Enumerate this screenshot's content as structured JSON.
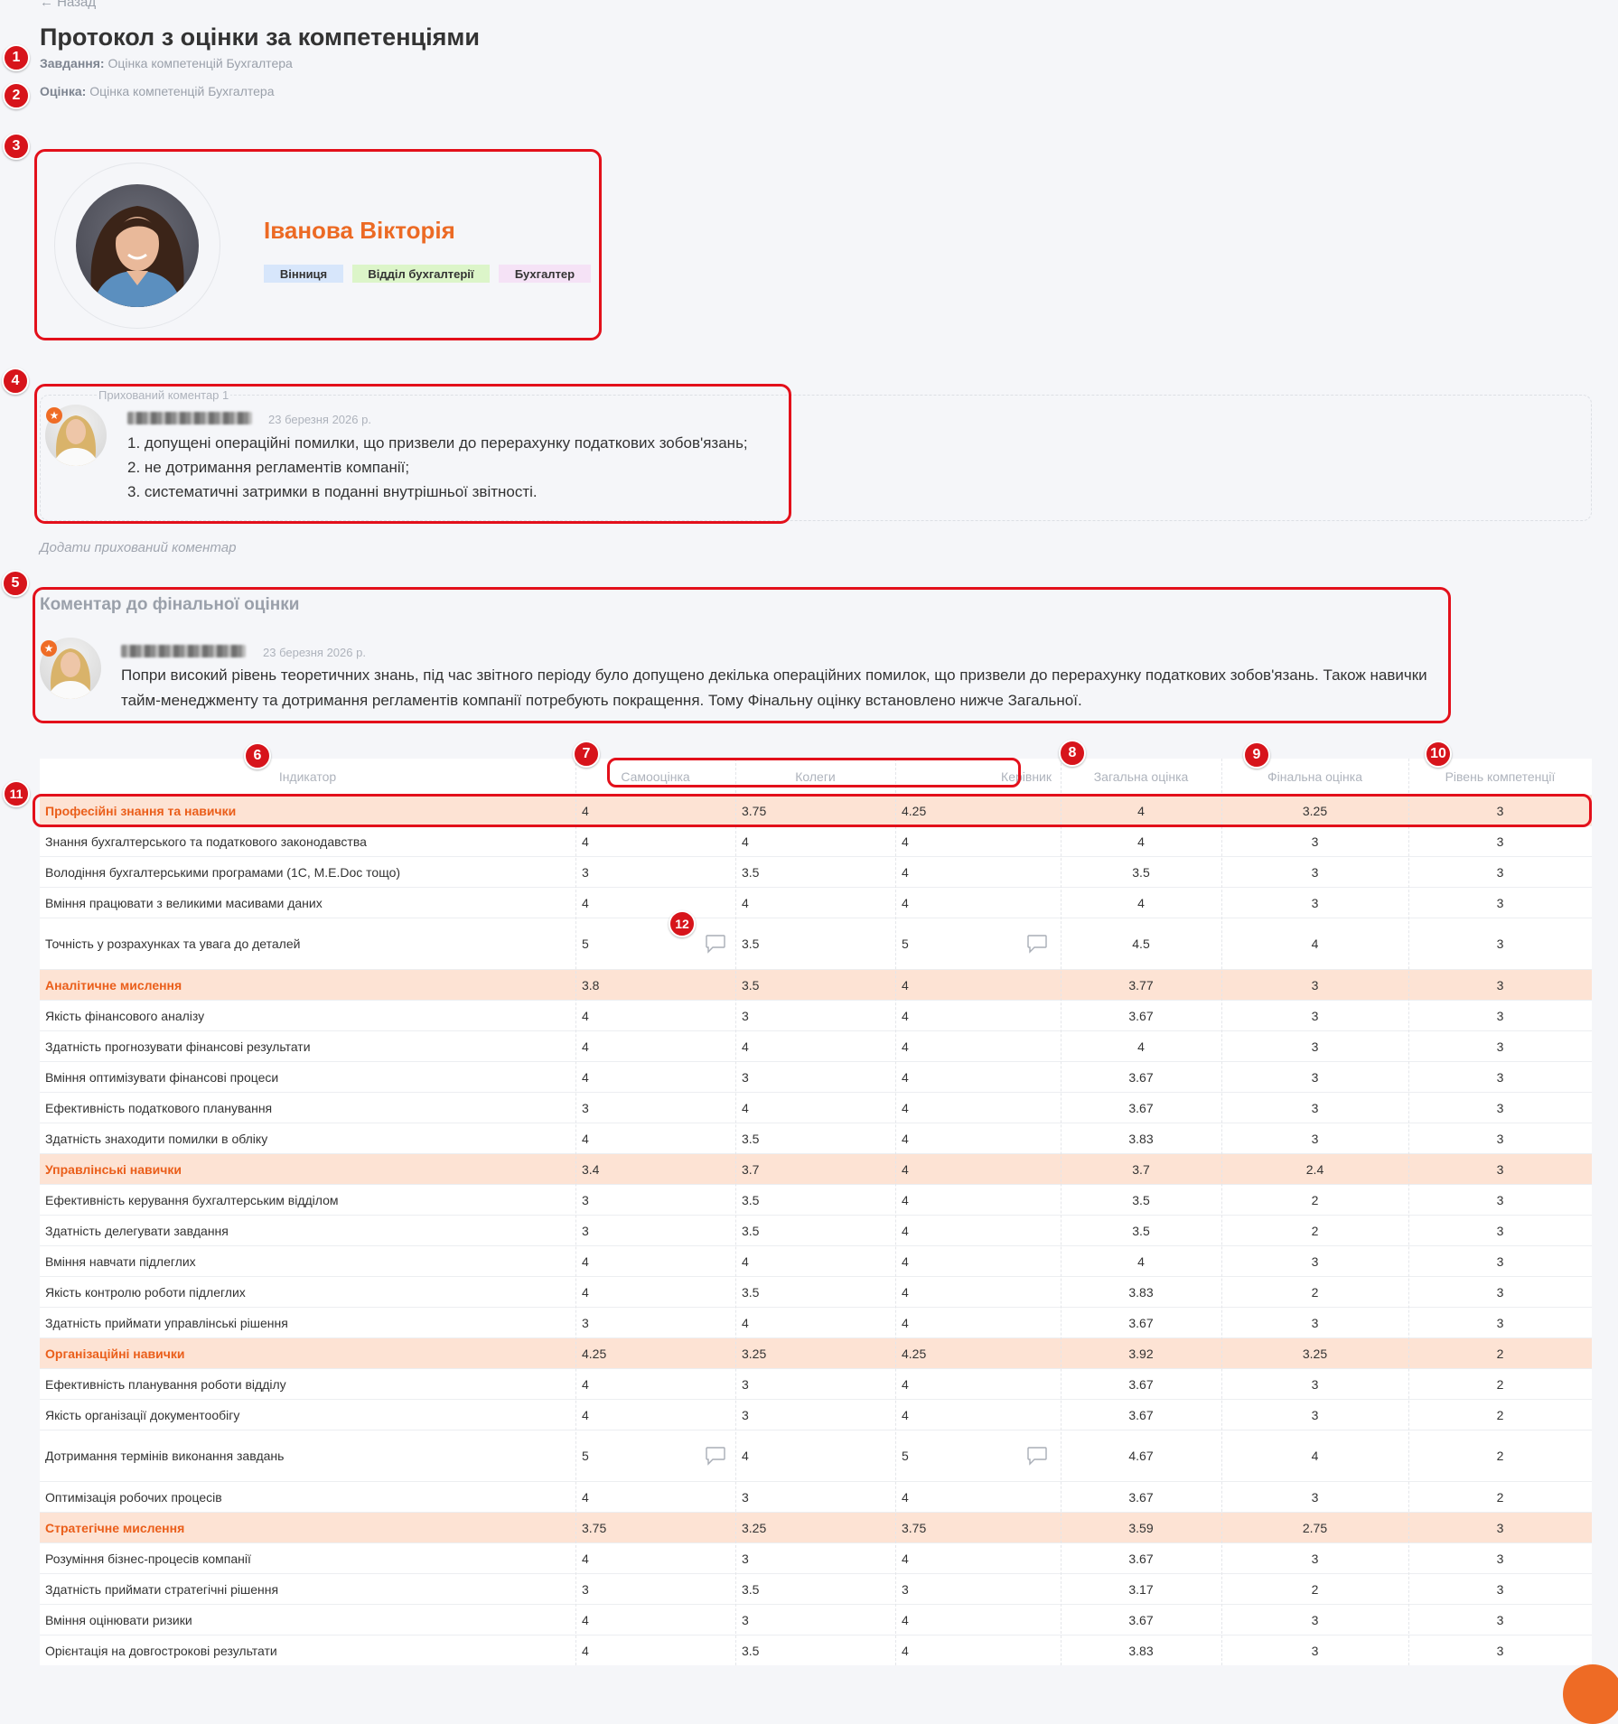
{
  "nav": {
    "back_label": "Назад"
  },
  "page": {
    "title": "Протокол з оцінки за компетенціями",
    "task_label": "Завдання:",
    "task_value": "Оцінка компетенцій Бухгалтера",
    "assessment_label": "Оцінка:",
    "assessment_value": "Оцінка компетенцій Бухгалтера"
  },
  "markers": [
    "1",
    "2",
    "3",
    "4",
    "5",
    "6",
    "7",
    "8",
    "9",
    "10",
    "11",
    "12"
  ],
  "employee": {
    "name": "Іванова Вікторія",
    "city": "Вінниця",
    "department": "Відділ бухгалтерії",
    "position": "Бухгалтер"
  },
  "hidden_comment": {
    "label": "Прихований коментар 1",
    "date": "23 березня 2026 р.",
    "lines": [
      "1. допущені операційні помилки, що призвели до перерахунку податкових зобов'язань;",
      "2. не дотримання регламентів компанії;",
      "3. систематичні затримки в поданні внутрішньої звітності."
    ],
    "add_label": "Додати прихований коментар"
  },
  "final_comment": {
    "title": "Коментар до фінальної оцінки",
    "date": "23 березня 2026 р.",
    "text": "Попри високий рівень теоретичних знань, під час звітного періоду було допущено декілька операційних помилок, що призвели до перерахунку податкових зобов'язань. Також навички тайм-менеджменту та дотримання регламентів компанії потребують покращення. Тому Фінальну оцінку встановлено нижче Загальної."
  },
  "table": {
    "headers": {
      "indicator": "Індикатор",
      "self": "Самооцінка",
      "colleagues": "Колеги",
      "manager": "Керівник",
      "overall": "Загальна оцінка",
      "final": "Фінальна оцінка",
      "level": "Рівень компетенції"
    },
    "rows": [
      {
        "cat": true,
        "name": "Професійні знання та навички",
        "v": [
          "4",
          "3.75",
          "4.25",
          "4",
          "3.25",
          "3"
        ]
      },
      {
        "cat": false,
        "name": "Знання бухгалтерського та податкового законодавства",
        "v": [
          "4",
          "4",
          "4",
          "4",
          "3",
          "3"
        ]
      },
      {
        "cat": false,
        "name": "Володіння бухгалтерськими програмами (1С, M.E.Doc тощо)",
        "v": [
          "3",
          "3.5",
          "4",
          "3.5",
          "3",
          "3"
        ]
      },
      {
        "cat": false,
        "name": "Вміння працювати з великими масивами даних",
        "v": [
          "4",
          "4",
          "4",
          "4",
          "3",
          "3"
        ]
      },
      {
        "cat": false,
        "name": "Точність у розрахунках та увага до деталей",
        "v": [
          "5",
          "3.5",
          "5",
          "4.5",
          "4",
          "3"
        ],
        "comments": true
      },
      {
        "cat": true,
        "name": "Аналітичне мислення",
        "v": [
          "3.8",
          "3.5",
          "4",
          "3.77",
          "3",
          "3"
        ]
      },
      {
        "cat": false,
        "name": "Якість фінансового аналізу",
        "v": [
          "4",
          "3",
          "4",
          "3.67",
          "3",
          "3"
        ]
      },
      {
        "cat": false,
        "name": "Здатність прогнозувати фінансові результати",
        "v": [
          "4",
          "4",
          "4",
          "4",
          "3",
          "3"
        ]
      },
      {
        "cat": false,
        "name": "Вміння оптимізувати фінансові процеси",
        "v": [
          "4",
          "3",
          "4",
          "3.67",
          "3",
          "3"
        ]
      },
      {
        "cat": false,
        "name": "Ефективність податкового планування",
        "v": [
          "3",
          "4",
          "4",
          "3.67",
          "3",
          "3"
        ]
      },
      {
        "cat": false,
        "name": "Здатність знаходити помилки в обліку",
        "v": [
          "4",
          "3.5",
          "4",
          "3.83",
          "3",
          "3"
        ]
      },
      {
        "cat": true,
        "name": "Управлінські навички",
        "v": [
          "3.4",
          "3.7",
          "4",
          "3.7",
          "2.4",
          "3"
        ]
      },
      {
        "cat": false,
        "name": "Ефективність керування бухгалтерським відділом",
        "v": [
          "3",
          "3.5",
          "4",
          "3.5",
          "2",
          "3"
        ]
      },
      {
        "cat": false,
        "name": "Здатність делегувати завдання",
        "v": [
          "3",
          "3.5",
          "4",
          "3.5",
          "2",
          "3"
        ]
      },
      {
        "cat": false,
        "name": "Вміння навчати підлеглих",
        "v": [
          "4",
          "4",
          "4",
          "4",
          "3",
          "3"
        ]
      },
      {
        "cat": false,
        "name": "Якість контролю роботи підлеглих",
        "v": [
          "4",
          "3.5",
          "4",
          "3.83",
          "2",
          "3"
        ]
      },
      {
        "cat": false,
        "name": "Здатність приймати управлінські рішення",
        "v": [
          "3",
          "4",
          "4",
          "3.67",
          "3",
          "3"
        ]
      },
      {
        "cat": true,
        "name": "Організаційні навички",
        "v": [
          "4.25",
          "3.25",
          "4.25",
          "3.92",
          "3.25",
          "2"
        ]
      },
      {
        "cat": false,
        "name": "Ефективність планування роботи відділу",
        "v": [
          "4",
          "3",
          "4",
          "3.67",
          "3",
          "2"
        ]
      },
      {
        "cat": false,
        "name": "Якість організації документообігу",
        "v": [
          "4",
          "3",
          "4",
          "3.67",
          "3",
          "2"
        ]
      },
      {
        "cat": false,
        "name": "Дотримання термінів виконання завдань",
        "v": [
          "5",
          "4",
          "5",
          "4.67",
          "4",
          "2"
        ],
        "comments": true
      },
      {
        "cat": false,
        "name": "Оптимізація робочих процесів",
        "v": [
          "4",
          "3",
          "4",
          "3.67",
          "3",
          "2"
        ]
      },
      {
        "cat": true,
        "name": "Стратегічне мислення",
        "v": [
          "3.75",
          "3.25",
          "3.75",
          "3.59",
          "2.75",
          "3"
        ]
      },
      {
        "cat": false,
        "name": "Розуміння бізнес-процесів компанії",
        "v": [
          "4",
          "3",
          "4",
          "3.67",
          "3",
          "3"
        ]
      },
      {
        "cat": false,
        "name": "Здатність приймати стратегічні рішення",
        "v": [
          "3",
          "3.5",
          "3",
          "3.17",
          "2",
          "3"
        ]
      },
      {
        "cat": false,
        "name": "Вміння оцінювати ризики",
        "v": [
          "4",
          "3",
          "4",
          "3.67",
          "3",
          "3"
        ]
      },
      {
        "cat": false,
        "name": "Орієнтація на довгострокові результати",
        "v": [
          "4",
          "3.5",
          "4",
          "3.83",
          "3",
          "3"
        ]
      }
    ]
  },
  "colors": {
    "accent": "#ec6a24",
    "category_bg": "#fde3d4",
    "marker": "#d7141b"
  }
}
